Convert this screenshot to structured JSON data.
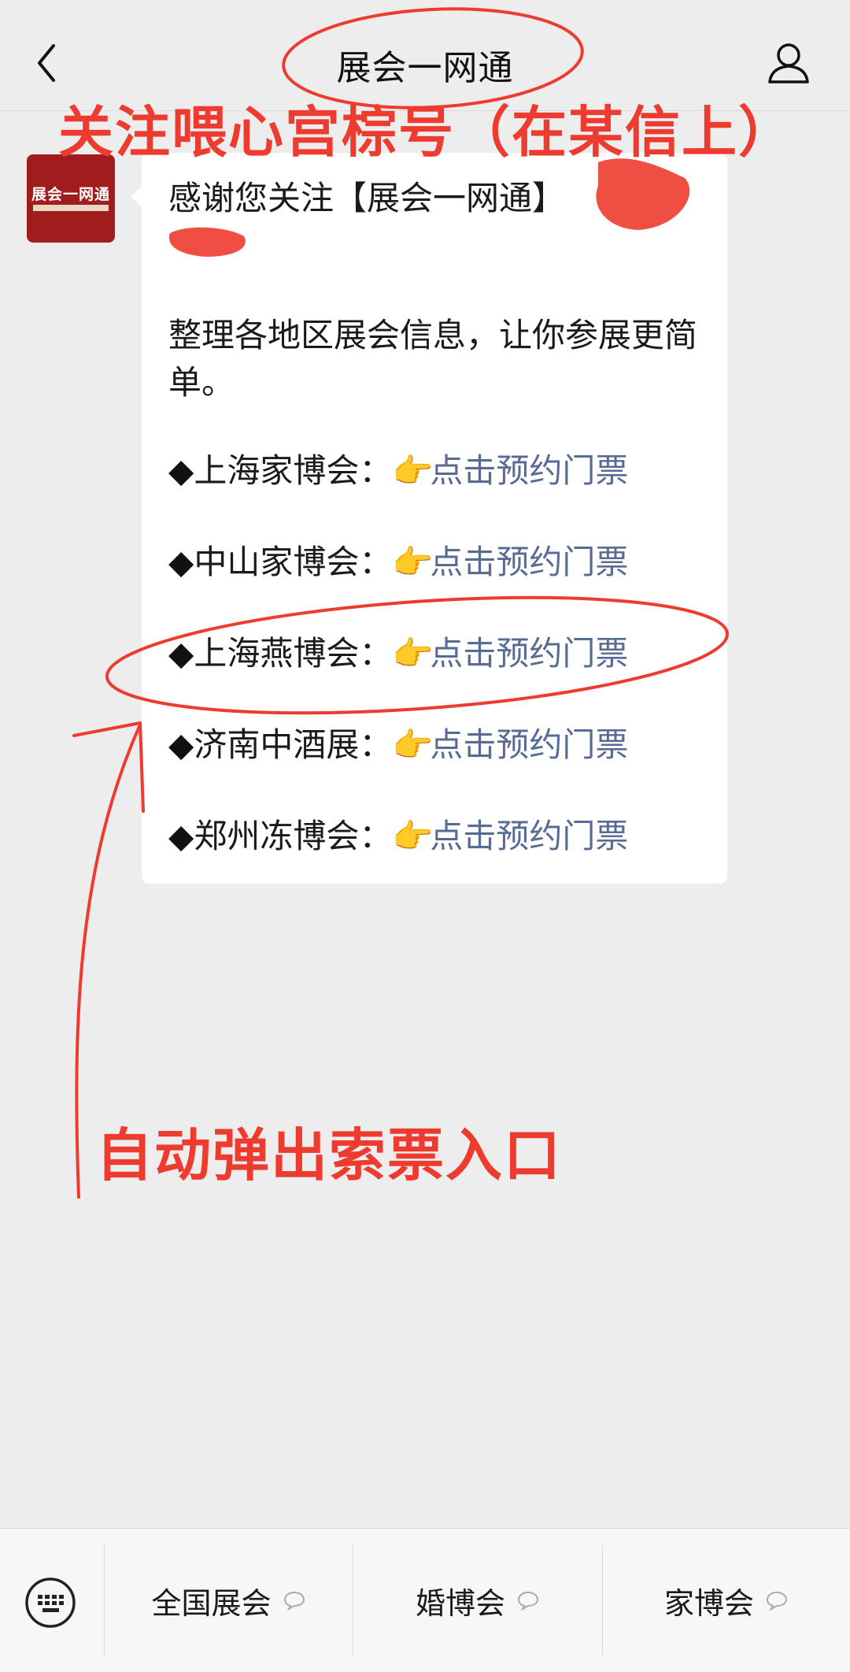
{
  "header": {
    "title": "展会一网通",
    "back_icon": "chevron-left-icon",
    "profile_icon": "user-icon"
  },
  "annotations": {
    "top": "关注喂心宫棕号（在某信上）",
    "bottom": "自动弹出索票入口",
    "color": "#ee3b2f"
  },
  "avatar": {
    "logo_text": "展会一网通",
    "color": "#a11d1d"
  },
  "message": {
    "line1": "感谢您关注【展会一网通】",
    "intro": "整理各地区展会信息，让你参展更简单。",
    "items": [
      {
        "name": "上海家博会：",
        "link": "点击预约门票"
      },
      {
        "name": "中山家博会：",
        "link": "点击预约门票"
      },
      {
        "name": "上海燕博会：",
        "link": "点击预约门票"
      },
      {
        "name": "济南中酒展：",
        "link": "点击预约门票"
      },
      {
        "name": "郑州冻博会：",
        "link": "点击预约门票"
      }
    ],
    "bullet": "◆",
    "link_color": "#576b95"
  },
  "bottom_menu": {
    "keyboard_icon": "keyboard-icon",
    "items": [
      {
        "label": "全国展会"
      },
      {
        "label": "婚博会"
      },
      {
        "label": "家博会"
      }
    ]
  }
}
